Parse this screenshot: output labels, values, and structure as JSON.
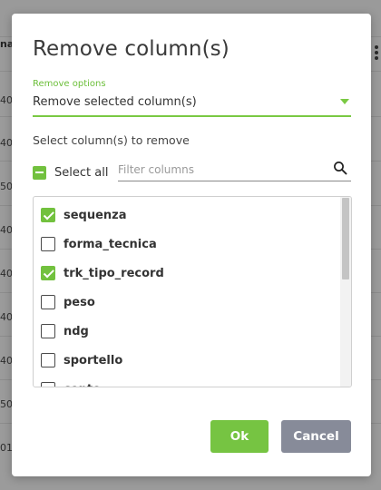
{
  "background": {
    "header_fragment": "na",
    "row_fragments": [
      "40",
      "40",
      "50",
      "40",
      "40",
      "40",
      "40",
      "50",
      "01"
    ]
  },
  "dialog": {
    "title": "Remove column(s)",
    "remove_options": {
      "label": "Remove options",
      "value": "Remove selected column(s)"
    },
    "section_label": "Select column(s) to remove",
    "select_all_label": "Select all",
    "select_all_state": "indeterminate",
    "filter_placeholder": "Filter columns",
    "filter_value": "",
    "columns": [
      {
        "label": "sequenza",
        "checked": true
      },
      {
        "label": "forma_tecnica",
        "checked": false
      },
      {
        "label": "trk_tipo_record",
        "checked": true
      },
      {
        "label": "peso",
        "checked": false
      },
      {
        "label": "ndg",
        "checked": false
      },
      {
        "label": "sportello",
        "checked": false
      },
      {
        "label": "conto",
        "checked": false
      }
    ],
    "ok_label": "Ok",
    "cancel_label": "Cancel"
  },
  "colors": {
    "accent": "#76c442",
    "cancel": "#878b99"
  },
  "icons": {
    "search": "search-icon",
    "dropdown": "chevron-down-icon",
    "background_menu": "kebab-menu-icon"
  }
}
